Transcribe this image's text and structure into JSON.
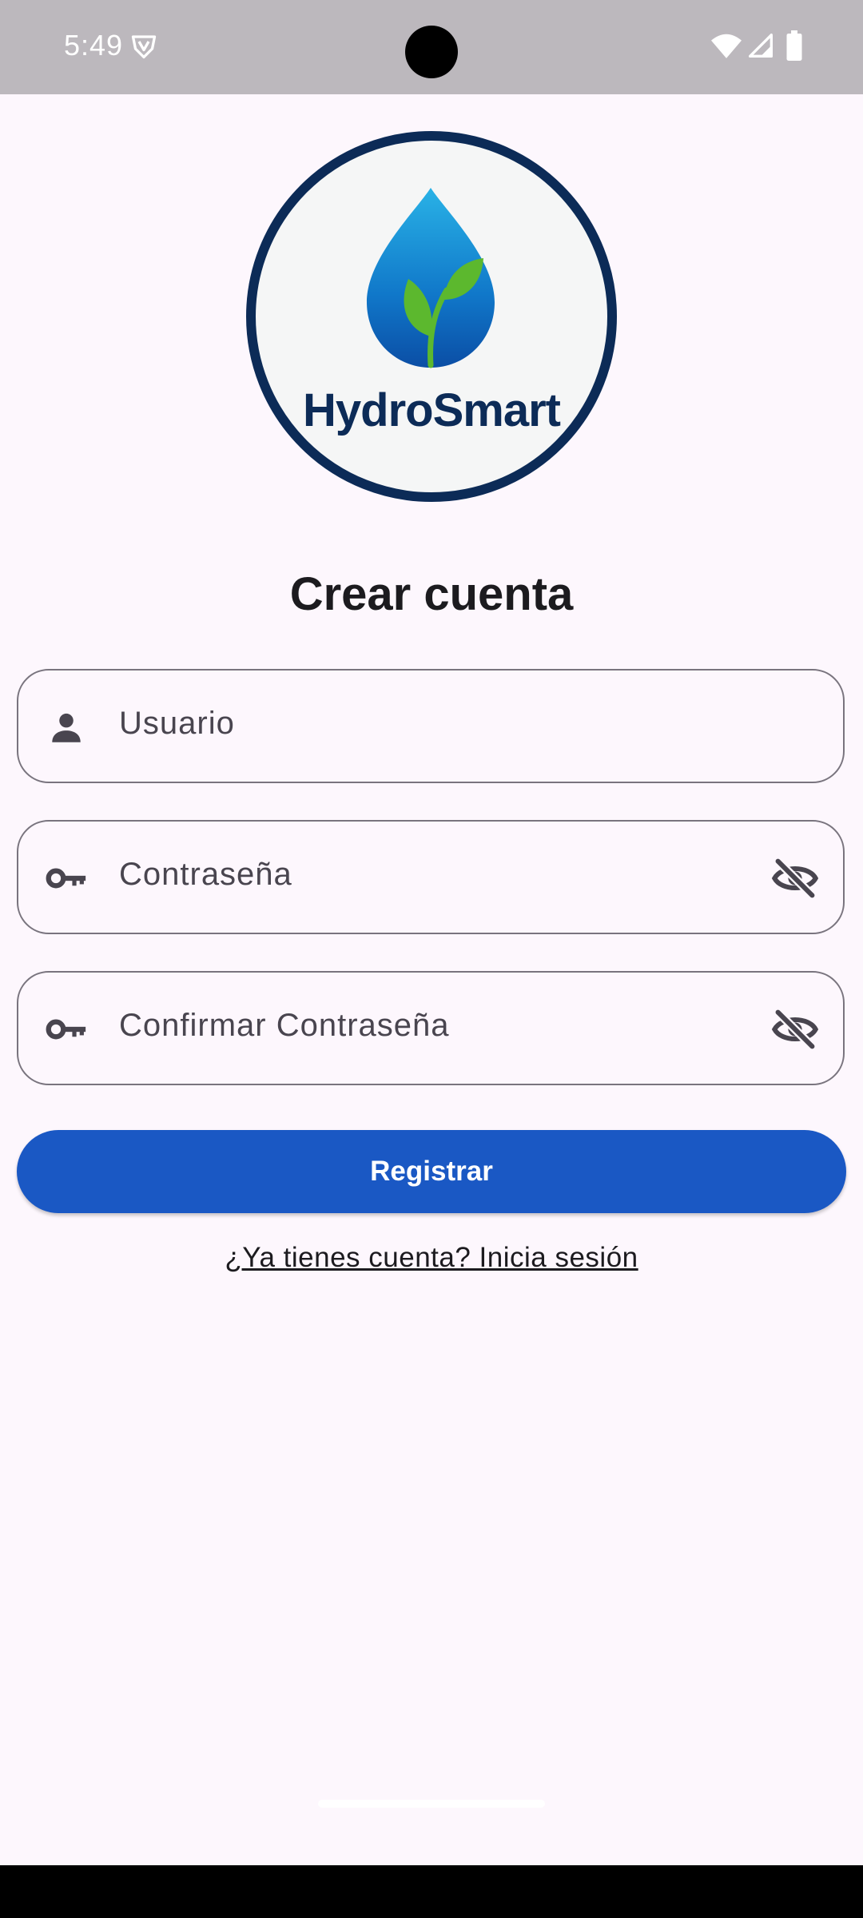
{
  "status_bar": {
    "time": "5:49",
    "icons": [
      "shield-icon",
      "wifi-icon",
      "signal-icon",
      "battery-icon"
    ]
  },
  "logo": {
    "brand": "HydroSmart",
    "icon": "water-drop-with-sprout"
  },
  "page": {
    "title": "Crear cuenta"
  },
  "form": {
    "username": {
      "placeholder": "Usuario",
      "value": "",
      "icon": "person-icon"
    },
    "password": {
      "placeholder": "Contraseña",
      "value": "",
      "icon": "key-icon",
      "toggle_icon": "visibility-off-icon"
    },
    "confirm_password": {
      "placeholder": "Confirmar Contraseña",
      "value": "",
      "icon": "key-icon",
      "toggle_icon": "visibility-off-icon"
    },
    "submit_label": "Registrar",
    "login_link": "¿Ya tienes cuenta? Inicia sesión"
  },
  "colors": {
    "background": "#fdf7fd",
    "primary_button": "#1a58c4",
    "logo_ring": "#0c2b57",
    "drop_blue": "#1077c9",
    "leaf_green": "#5cb82e",
    "status_bar": "#bcb8bd",
    "outline": "#79747e"
  }
}
